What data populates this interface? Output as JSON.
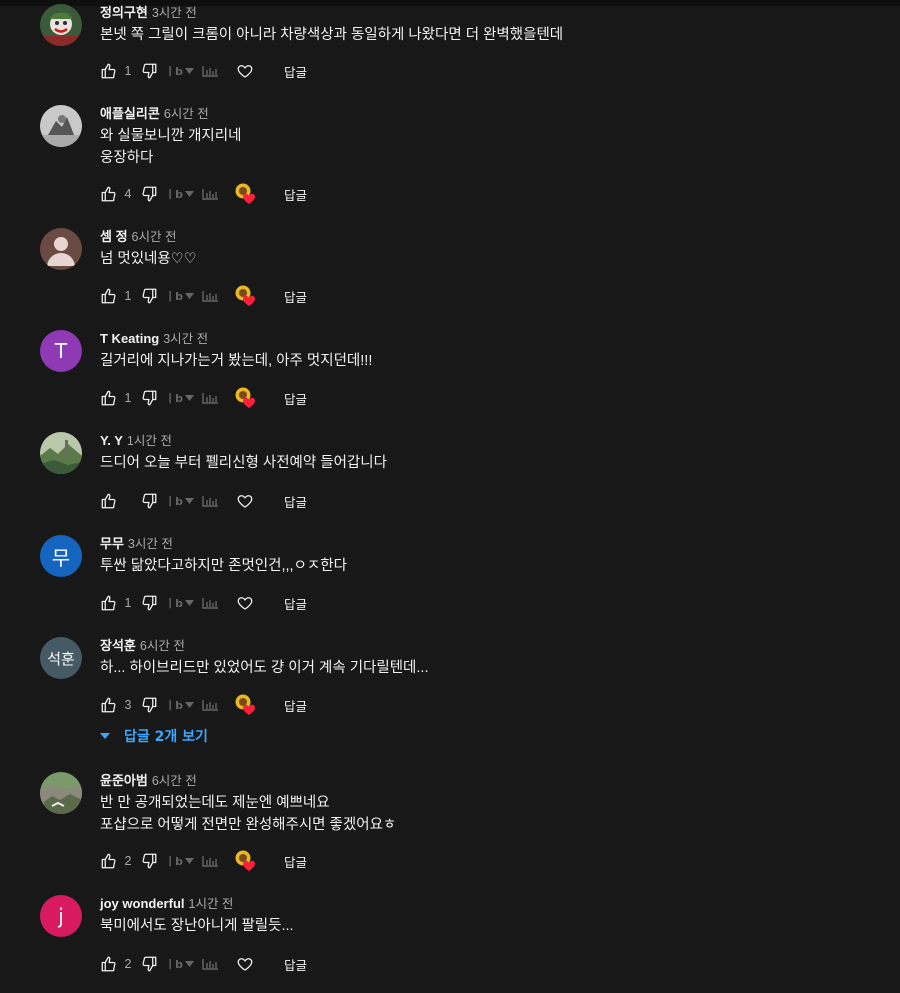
{
  "labels": {
    "reply": "답글",
    "view_replies": "답글 2개 보기"
  },
  "colors": {
    "background": "#181818",
    "link": "#3ea6ff",
    "heart": "#ff1f3d"
  },
  "comments": [
    {
      "author": "정의구현",
      "time": "3시간 전",
      "lines": [
        "본넷 쪽 그릴이 크롬이 아니라 차량색상과 동일하게 나왔다면 더 완벽했을텐데"
      ],
      "likes": "1",
      "hearted": false,
      "avatar": {
        "type": "image",
        "icon": "joker-avatar"
      }
    },
    {
      "author": "애플실리콘",
      "time": "6시간 전",
      "lines": [
        "와 실물보니깐 개지리네",
        "웅장하다"
      ],
      "likes": "4",
      "hearted": true,
      "avatar": {
        "type": "image",
        "icon": "statue-avatar"
      }
    },
    {
      "author": "셈 정",
      "time": "6시간 전",
      "lines": [
        "넘 멋있네용♡♡"
      ],
      "likes": "1",
      "hearted": true,
      "avatar": {
        "type": "image",
        "icon": "default-user-avatar"
      }
    },
    {
      "author": "T Keating",
      "time": "3시간 전",
      "lines": [
        "길거리에 지나가는거 봤는데, 아주 멋지던데!!!"
      ],
      "likes": "1",
      "hearted": true,
      "avatar": {
        "type": "letter",
        "letter": "T",
        "color": "#8e3ab5"
      }
    },
    {
      "author": "Y. Y",
      "time": "1시간 전",
      "lines": [
        "드디어 오늘 부터 펠리신형 사전예약 들어갑니다"
      ],
      "likes": "",
      "hearted": false,
      "avatar": {
        "type": "image",
        "icon": "landscape-avatar"
      }
    },
    {
      "author": "무무",
      "time": "3시간 전",
      "lines": [
        "투싼 닮았다고하지만 존멋인건,,,ㅇㅈ한다"
      ],
      "likes": "1",
      "hearted": false,
      "avatar": {
        "type": "letter",
        "letter": "무",
        "color": "#1565c0"
      }
    },
    {
      "author": "장석훈",
      "time": "6시간 전",
      "lines": [
        "하... 하이브리드만 있었어도 걍 이거 계속 기다릴텐데..."
      ],
      "likes": "3",
      "hearted": true,
      "avatar": {
        "type": "letter",
        "letter": "석훈",
        "color": "#455a64"
      }
    },
    {
      "author": "윤준아범",
      "time": "6시간 전",
      "lines": [
        "반 만 공개되었는데도 제눈엔 예쁘네요",
        "포샵으로 어떻게 전면만 완성해주시면 좋겠어요ㅎ"
      ],
      "likes": "2",
      "hearted": true,
      "avatar": {
        "type": "image",
        "icon": "rock-landscape-avatar"
      }
    },
    {
      "author": "joy wonderful",
      "time": "1시간 전",
      "lines": [
        "북미에서도 장난아니게 팔릴듯..."
      ],
      "likes": "2",
      "hearted": false,
      "avatar": {
        "type": "letter",
        "letter": "j",
        "color": "#d81b60"
      }
    }
  ]
}
